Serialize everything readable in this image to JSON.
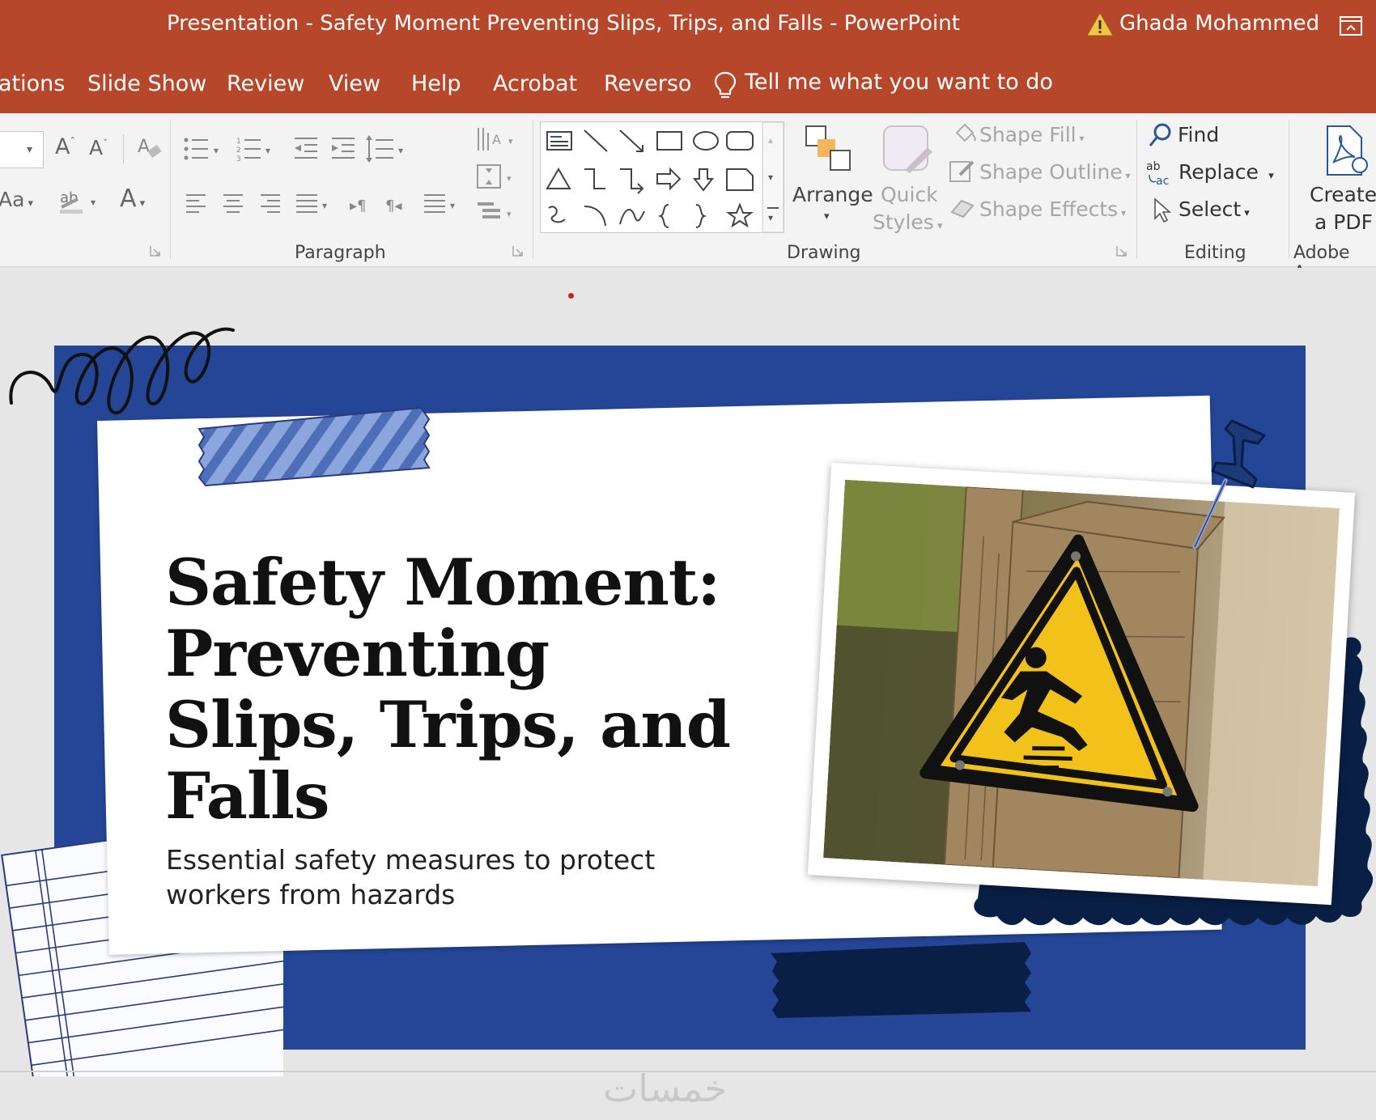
{
  "window": {
    "title": "Presentation - Safety Moment Preventing Slips, Trips, and Falls  -  PowerPoint",
    "user": "Ghada Mohammed"
  },
  "tabs": [
    "ations",
    "Slide Show",
    "Review",
    "View",
    "Help",
    "Acrobat",
    "Reverso"
  ],
  "tell_me": "Tell me what you want to do",
  "ribbon": {
    "font_group": {
      "change_case": "Aa"
    },
    "paragraph_label": "Paragraph",
    "drawing": {
      "label": "Drawing",
      "arrange": "Arrange",
      "quick_styles_1": "Quick",
      "quick_styles_2": "Styles",
      "shape_fill": "Shape Fill",
      "shape_outline": "Shape Outline",
      "shape_effects": "Shape Effects"
    },
    "editing": {
      "label": "Editing",
      "find": "Find",
      "replace": "Replace",
      "select": "Select"
    },
    "acrobat": {
      "create_1": "Create",
      "create_2": "a PDF",
      "label": "Adobe Ac"
    }
  },
  "slide": {
    "title": "Safety Moment: Preventing Slips, Trips, and Falls",
    "subtitle": "Essential safety measures to protect workers from hazards"
  },
  "watermark": "خمسات",
  "colors": {
    "accent": "#b7472a",
    "slide_background": "#254597",
    "navy": "#0a1f45",
    "tape_light": "#8aa6dc",
    "warning_yellow": "#f2c21b"
  }
}
